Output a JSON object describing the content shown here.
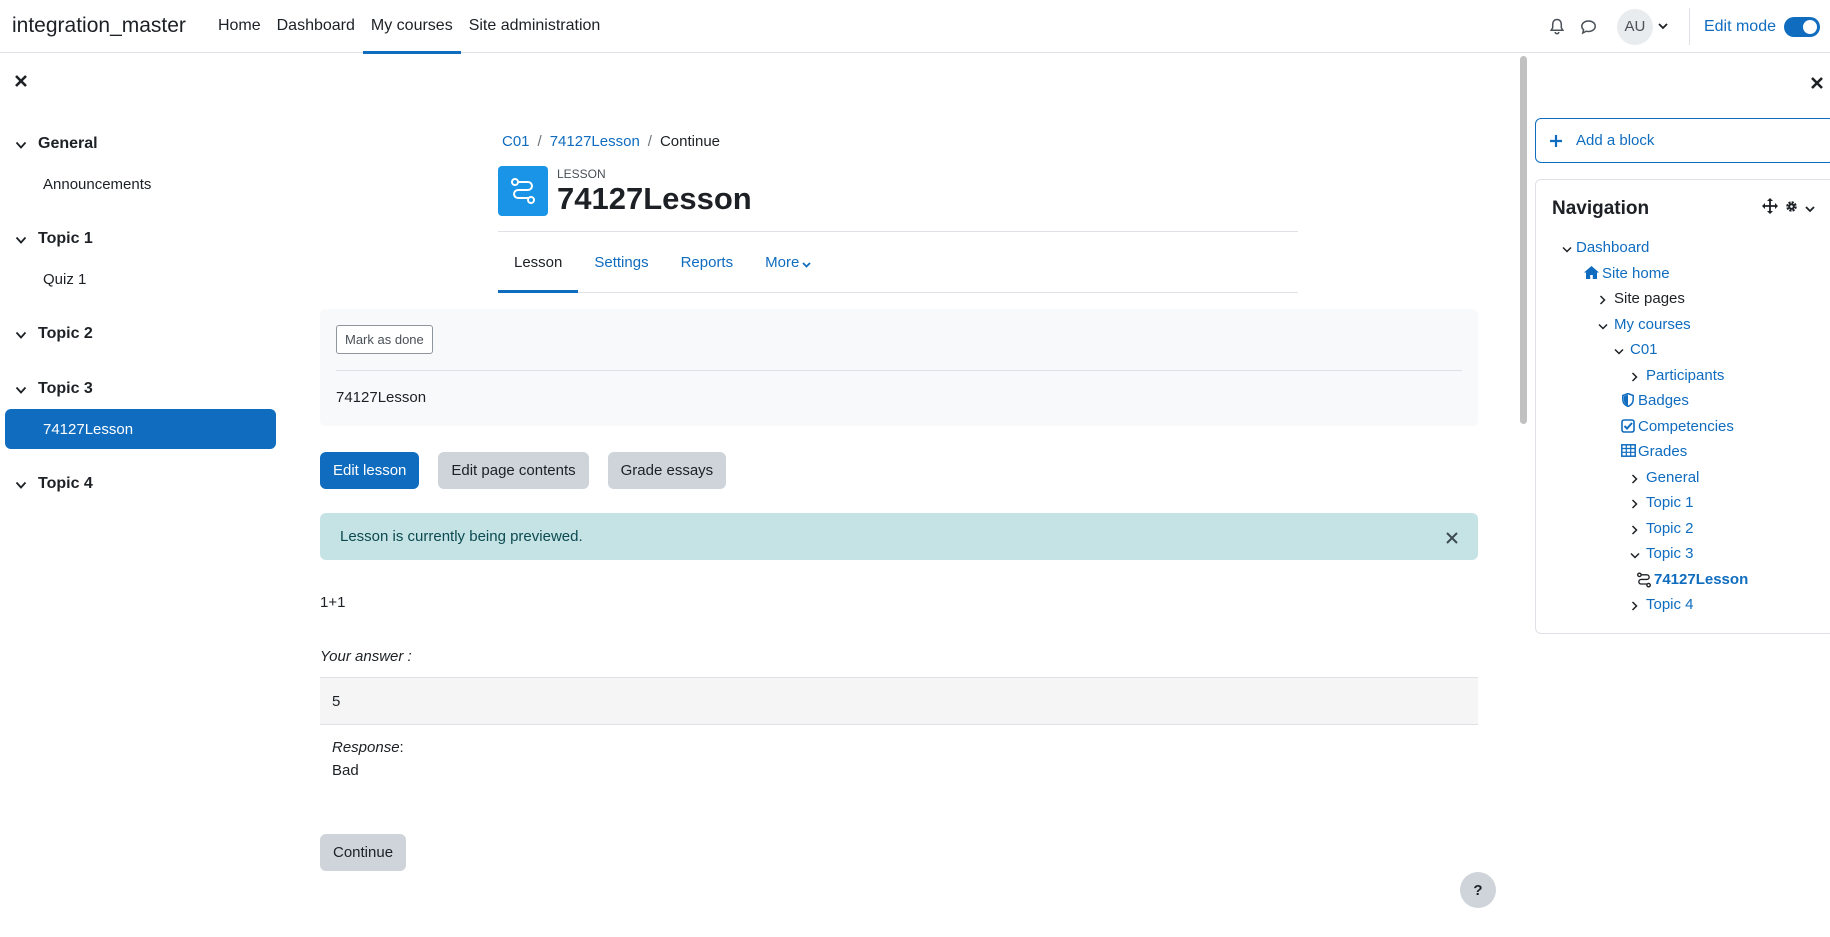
{
  "topbar": {
    "brand": "integration_master",
    "nav": [
      {
        "label": "Home",
        "active": false
      },
      {
        "label": "Dashboard",
        "active": false
      },
      {
        "label": "My courses",
        "active": true
      },
      {
        "label": "Site administration",
        "active": false
      }
    ],
    "avatar_initials": "AU",
    "edit_mode_label": "Edit mode",
    "edit_mode_on": true
  },
  "course_index": {
    "sections": [
      {
        "title": "General",
        "items": [
          "Announcements"
        ]
      },
      {
        "title": "Topic 1",
        "items": [
          "Quiz 1"
        ]
      },
      {
        "title": "Topic 2",
        "items": []
      },
      {
        "title": "Topic 3",
        "items": [
          "74127Lesson"
        ]
      },
      {
        "title": "Topic 4",
        "items": []
      }
    ],
    "active_item": "74127Lesson"
  },
  "breadcrumb": [
    "C01",
    "74127Lesson",
    "Continue"
  ],
  "header": {
    "activity_type": "LESSON",
    "title": "74127Lesson"
  },
  "secondary_nav": [
    {
      "label": "Lesson",
      "active": true
    },
    {
      "label": "Settings",
      "active": false
    },
    {
      "label": "Reports",
      "active": false
    },
    {
      "label": "More",
      "active": false,
      "dropdown": true
    }
  ],
  "completion": {
    "button_label": "Mark as done",
    "description": "74127Lesson"
  },
  "actions": {
    "edit_lesson": "Edit lesson",
    "edit_page_contents": "Edit page contents",
    "grade_essays": "Grade essays"
  },
  "alert": {
    "message": "Lesson is currently being previewed."
  },
  "question": {
    "text": "1+1",
    "your_answer_label": "Your answer :",
    "answer_value": "5",
    "response_label": "Response",
    "response_value": "Bad"
  },
  "continue_label": "Continue",
  "help_label": "?",
  "right_drawer": {
    "add_block_label": "Add a block",
    "navigation": {
      "title": "Navigation",
      "tree": [
        {
          "label": "Dashboard",
          "style": "link",
          "chev": "down"
        },
        {
          "label": "Site home",
          "style": "link",
          "icon": "home"
        },
        {
          "label": "Site pages",
          "style": "plain",
          "chev": "right"
        },
        {
          "label": "My courses",
          "style": "link",
          "chev": "down"
        },
        {
          "label": "C01",
          "style": "link",
          "chev": "down"
        },
        {
          "label": "Participants",
          "style": "link",
          "chev": "right"
        },
        {
          "label": "Badges",
          "style": "link",
          "icon": "shield"
        },
        {
          "label": "Competencies",
          "style": "link",
          "icon": "check-square"
        },
        {
          "label": "Grades",
          "style": "link",
          "icon": "table"
        },
        {
          "label": "General",
          "style": "link",
          "chev": "right"
        },
        {
          "label": "Topic 1",
          "style": "link",
          "chev": "right"
        },
        {
          "label": "Topic 2",
          "style": "link",
          "chev": "right"
        },
        {
          "label": "Topic 3",
          "style": "link",
          "chev": "down"
        },
        {
          "label": "74127Lesson",
          "style": "bold",
          "icon": "lesson"
        },
        {
          "label": "Topic 4",
          "style": "link",
          "chev": "right"
        }
      ]
    }
  }
}
